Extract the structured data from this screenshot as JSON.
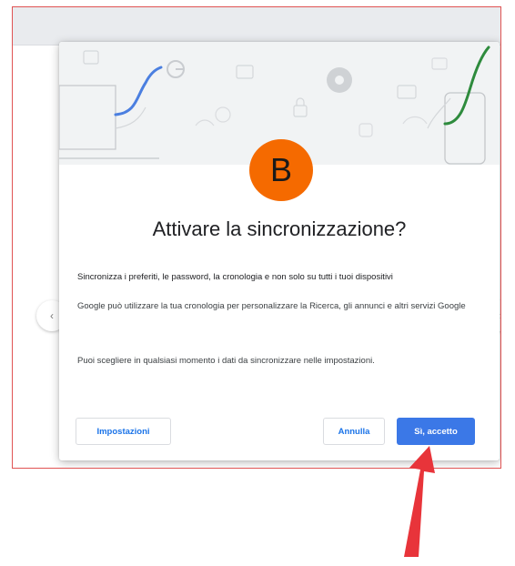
{
  "badge": {
    "letter": "B",
    "color": "#f56a00"
  },
  "dialog": {
    "title": "Attivare la sincronizzazione?",
    "line1": "Sincronizza i preferiti, le password, la cronologia e non solo su tutti i tuoi dispositivi",
    "line2": "Google può utilizzare la tua cronologia per personalizzare la Ricerca, gli annunci e altri servizi Google",
    "line3": "Puoi scegliere in qualsiasi momento i dati da sincronizzare nelle impostazioni.",
    "settings_label": "Impostazioni",
    "cancel_label": "Annulla",
    "accept_label": "Sì, accetto"
  },
  "colors": {
    "frame": "#e05353",
    "arrow": "#e8343a",
    "primary": "#3b78e7",
    "link": "#1a73e8"
  },
  "icons": [
    "chevron-left-icon",
    "chevron-right-icon",
    "google-g-icon",
    "chrome-icon",
    "lock-icon",
    "phone-icon",
    "laptop-icon"
  ]
}
